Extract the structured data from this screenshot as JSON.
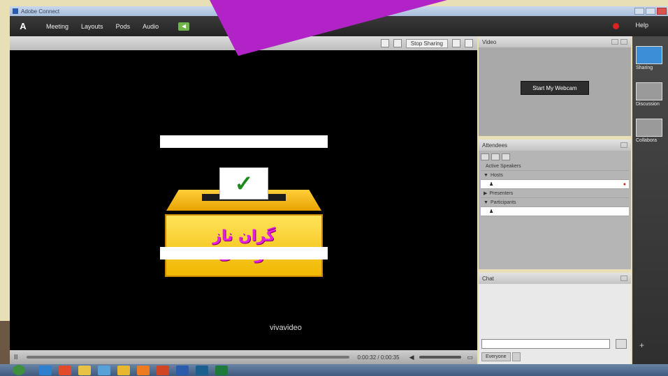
{
  "window": {
    "title": "Adobe Connect"
  },
  "menubar": {
    "logo": "A",
    "items": [
      "Meeting",
      "Layouts",
      "Pods",
      "Audio"
    ],
    "help": "Help"
  },
  "share_pod": {
    "title": "",
    "stop_label": "Stop Sharing",
    "slide": {
      "check": "✓",
      "line1": "گران ناز",
      "line2": "توسلی",
      "watermark": "vivavideo"
    },
    "player": {
      "play": "II",
      "time": "0:00:32 / 0:00:35"
    }
  },
  "video_pod": {
    "title": "Video",
    "webcam_button": "Start My Webcam"
  },
  "attendees_pod": {
    "title": "Attendees",
    "rows": [
      {
        "kind": "group",
        "caret": "",
        "label": "Active Speakers"
      },
      {
        "kind": "group",
        "caret": "▼",
        "label": "Hosts"
      },
      {
        "kind": "user",
        "label": "",
        "mic": "●"
      },
      {
        "kind": "group",
        "caret": "▶",
        "label": "Presenters"
      },
      {
        "kind": "group",
        "caret": "▼",
        "label": "Participants"
      },
      {
        "kind": "user",
        "label": "",
        "mic": ""
      }
    ]
  },
  "chat_pod": {
    "title": "Chat",
    "messages": [
      {
        "who": "",
        "text": ""
      },
      {
        "who": "",
        "text": ""
      },
      {
        "who": "",
        "text": ""
      }
    ],
    "tabs": [
      "Everyone"
    ]
  },
  "layout_bar": {
    "items": [
      {
        "label": "Sharing",
        "active": true
      },
      {
        "label": "Discussion",
        "active": false
      },
      {
        "label": "Collabora",
        "active": false
      }
    ],
    "add": "+"
  },
  "taskbar": {
    "icons": [
      "ie",
      "media",
      "folder",
      "browser",
      "chrome",
      "firefox",
      "powerpoint",
      "word",
      "photoshop",
      "excel"
    ],
    "icon_colors": [
      "#2f7fd1",
      "#e14b2b",
      "#e8c244",
      "#58a0d8",
      "#e8b72f",
      "#ef7b21",
      "#d04523",
      "#2b5bab",
      "#1b5f8f",
      "#1e7a3c"
    ]
  }
}
